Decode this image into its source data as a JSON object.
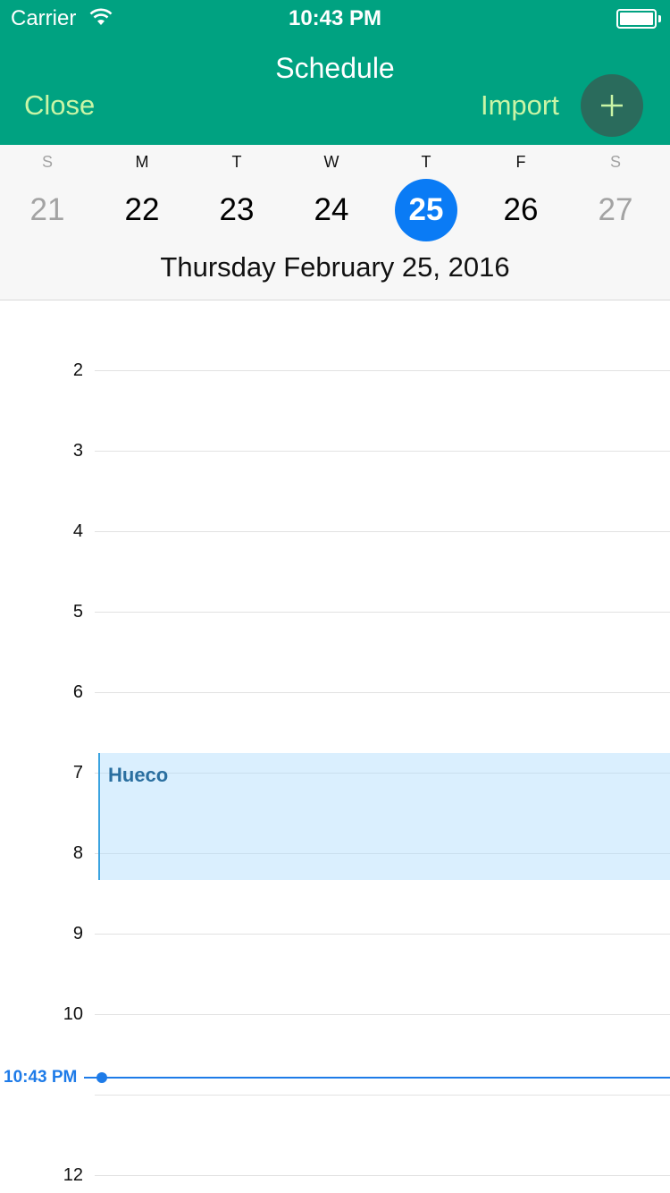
{
  "status_bar": {
    "carrier": "Carrier",
    "time": "10:43 PM",
    "wifi_icon": "wifi-icon",
    "battery_icon": "battery-icon"
  },
  "nav": {
    "title": "Schedule",
    "close_label": "Close",
    "import_label": "Import",
    "add_icon": "plus-icon"
  },
  "week": {
    "days": [
      {
        "letter": "S",
        "number": "21",
        "weekend": true,
        "selected": false
      },
      {
        "letter": "M",
        "number": "22",
        "weekend": false,
        "selected": false
      },
      {
        "letter": "T",
        "number": "23",
        "weekend": false,
        "selected": false
      },
      {
        "letter": "W",
        "number": "24",
        "weekend": false,
        "selected": false
      },
      {
        "letter": "T",
        "number": "25",
        "weekend": false,
        "selected": true
      },
      {
        "letter": "F",
        "number": "26",
        "weekend": false,
        "selected": false
      },
      {
        "letter": "S",
        "number": "27",
        "weekend": true,
        "selected": false
      }
    ],
    "selected_date_label": "Thursday February 25, 2016"
  },
  "timeline": {
    "hours": [
      "2",
      "3",
      "4",
      "5",
      "6",
      "7",
      "8",
      "9",
      "10",
      "12"
    ],
    "event": {
      "title": "Hueco"
    },
    "now_label": "10:43 PM"
  },
  "colors": {
    "header": "#00a281",
    "accent_text": "#c9f5a6",
    "add_button": "#2a6b5c",
    "selected_day": "#0a7bf5",
    "now_indicator": "#1e7be8",
    "event_fill": "#d6ecfb"
  }
}
